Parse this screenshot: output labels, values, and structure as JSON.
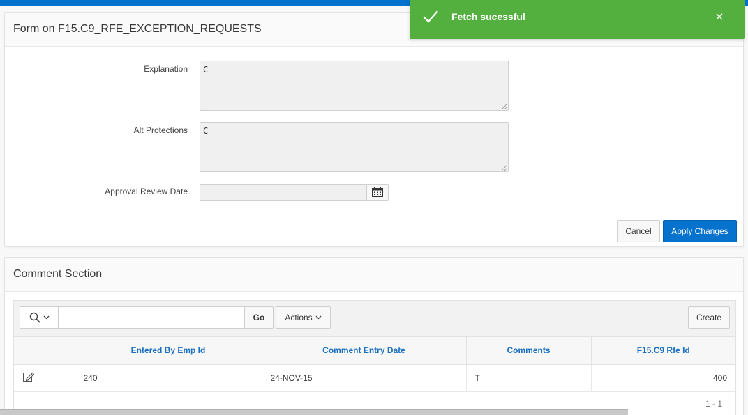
{
  "form": {
    "title": "Form on F15.C9_RFE_EXCEPTION_REQUESTS",
    "explanation_label": "Explanation",
    "explanation_value": "C",
    "alt_protections_label": "Alt Protections",
    "alt_protections_value": "C",
    "approval_review_date_label": "Approval Review Date",
    "approval_review_date_value": "",
    "cancel_label": "Cancel",
    "apply_label": "Apply Changes"
  },
  "comments": {
    "title": "Comment Section",
    "go_label": "Go",
    "actions_label": "Actions",
    "create_label": "Create",
    "columns": [
      "Entered By Emp Id",
      "Comment Entry Date",
      "Comments",
      "F15.C9 Rfe Id"
    ],
    "rows": [
      {
        "emp_id": "240",
        "entry_date": "24-NOV-15",
        "comments": "T",
        "rfe_id": "400"
      }
    ],
    "pagination": "1 - 1"
  },
  "toast": {
    "message": "Fetch sucessful",
    "close_glyph": "×"
  },
  "icons": {
    "calendar": "calendar-icon",
    "search": "search-icon",
    "edit": "edit-icon",
    "check": "check-icon"
  },
  "colors": {
    "accent": "#0572ce",
    "success": "#53b03f",
    "header_link": "#1a6fc0"
  }
}
